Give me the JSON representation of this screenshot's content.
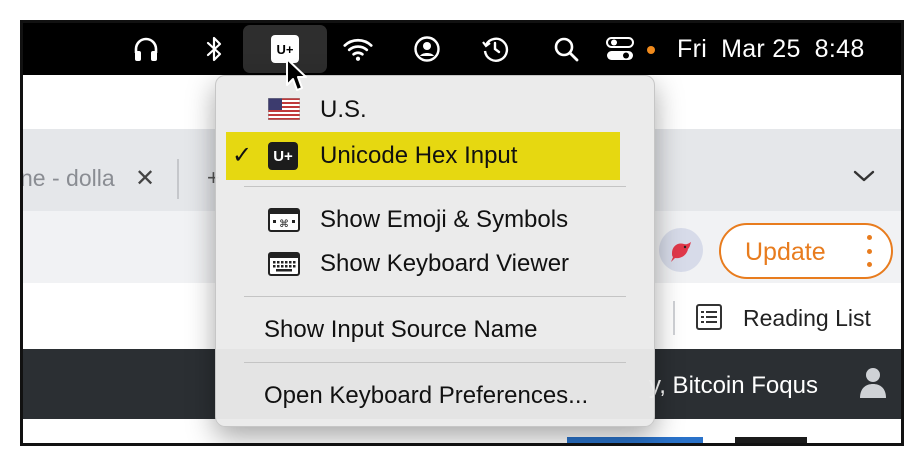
{
  "menubar": {
    "icons": [
      "headphones-icon",
      "bluetooth-icon",
      "input-source-icon",
      "wifi-icon",
      "user-account-icon",
      "time-machine-icon",
      "spotlight-search-icon",
      "control-center-icon"
    ],
    "input_source_glyph": "U+",
    "clock": {
      "day": "Fri",
      "date": "Mar 25",
      "time": "8:48"
    },
    "accent_dot_color": "#f08a1c"
  },
  "browser": {
    "tab_title": "ne - dolla",
    "tab_close": "✕",
    "tab_add": "+",
    "update_button": "Update",
    "reading_list": "Reading List",
    "banner_text": "y, Bitcoin Foqus",
    "accent_color": "#e87c1e"
  },
  "input_menu": {
    "sources": [
      {
        "label": "U.S.",
        "icon": "us-flag-icon",
        "selected": false
      },
      {
        "label": "Unicode Hex Input",
        "icon": "unicode-hex-icon",
        "glyph": "U+",
        "selected": true
      }
    ],
    "checkmark": "✓",
    "highlight_color": "#e6d811",
    "actions": [
      {
        "label": "Show Emoji & Symbols",
        "icon": "emoji-symbols-icon"
      },
      {
        "label": "Show Keyboard Viewer",
        "icon": "keyboard-viewer-icon"
      }
    ],
    "show_input_source_name": "Show Input Source Name",
    "open_keyboard_preferences": "Open Keyboard Preferences..."
  }
}
